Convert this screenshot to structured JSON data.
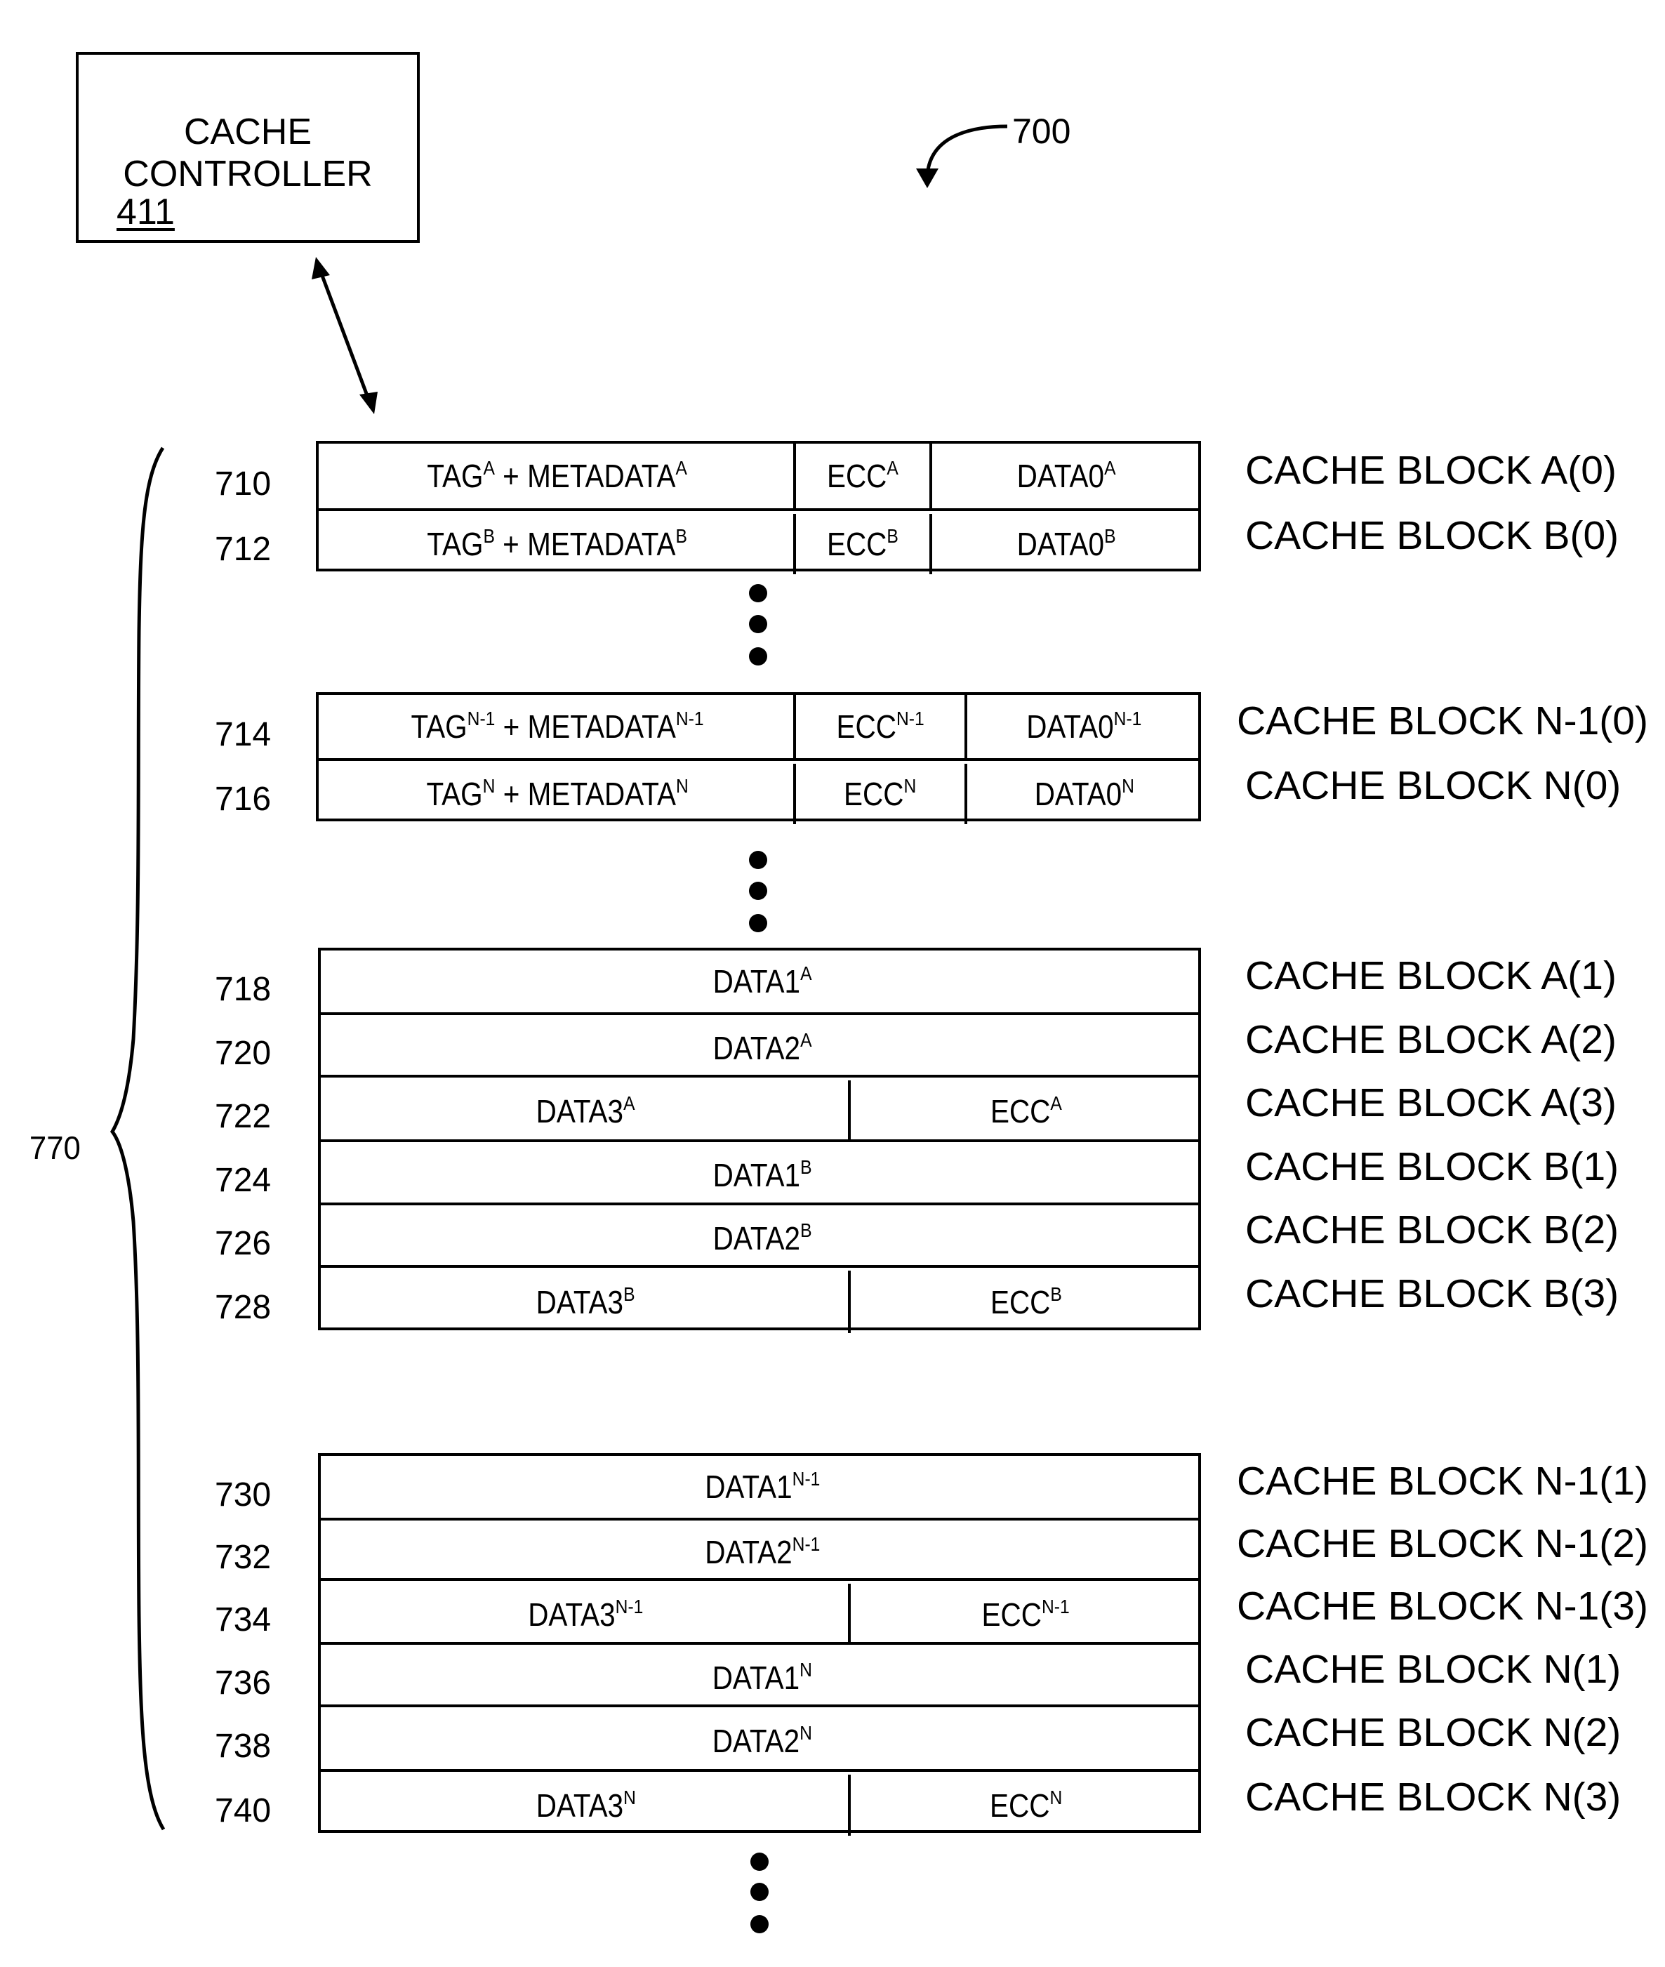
{
  "figure_ref": "700",
  "brace_ref": "770",
  "controller": {
    "line1": "CACHE",
    "line2": "CONTROLLER",
    "ref": "411"
  },
  "groups": [
    {
      "rows": [
        {
          "ref": "710",
          "label": "CACHE BLOCK A(0)",
          "cells": [
            {
              "text": "TAG",
              "sup": "A",
              "text2": " + METADATA",
              "sup2": "A"
            },
            {
              "text": "ECC",
              "sup": "A"
            },
            {
              "text": "DATA0",
              "sup": "A"
            }
          ]
        },
        {
          "ref": "712",
          "label": "CACHE BLOCK B(0)",
          "cells": [
            {
              "text": "TAG",
              "sup": "B",
              "text2": " + METADATA",
              "sup2": "B"
            },
            {
              "text": "ECC",
              "sup": "B"
            },
            {
              "text": "DATA0",
              "sup": "B"
            }
          ]
        }
      ]
    },
    {
      "rows": [
        {
          "ref": "714",
          "label": "CACHE BLOCK N-1(0)",
          "cells": [
            {
              "text": "TAG",
              "sup": "N-1",
              "text2": " + METADATA",
              "sup2": "N-1"
            },
            {
              "text": "ECC",
              "sup": "N-1"
            },
            {
              "text": "DATA0",
              "sup": "N-1"
            }
          ]
        },
        {
          "ref": "716",
          "label": "CACHE BLOCK N(0)",
          "cells": [
            {
              "text": "TAG",
              "sup": "N",
              "text2": " + METADATA",
              "sup2": "N"
            },
            {
              "text": "ECC",
              "sup": "N"
            },
            {
              "text": "DATA0",
              "sup": "N"
            }
          ]
        }
      ]
    },
    {
      "rows": [
        {
          "ref": "718",
          "label": "CACHE BLOCK A(1)",
          "cells": [
            {
              "text": "DATA1",
              "sup": "A"
            }
          ]
        },
        {
          "ref": "720",
          "label": "CACHE BLOCK A(2)",
          "cells": [
            {
              "text": "DATA2",
              "sup": "A"
            }
          ]
        },
        {
          "ref": "722",
          "label": "CACHE BLOCK A(3)",
          "cells": [
            {
              "text": "DATA3",
              "sup": "A"
            },
            {
              "text": "ECC",
              "sup": "A"
            }
          ]
        },
        {
          "ref": "724",
          "label": "CACHE BLOCK B(1)",
          "cells": [
            {
              "text": "DATA1",
              "sup": "B"
            }
          ]
        },
        {
          "ref": "726",
          "label": "CACHE BLOCK B(2)",
          "cells": [
            {
              "text": "DATA2",
              "sup": "B"
            }
          ]
        },
        {
          "ref": "728",
          "label": "CACHE BLOCK B(3)",
          "cells": [
            {
              "text": "DATA3",
              "sup": "B"
            },
            {
              "text": "ECC",
              "sup": "B"
            }
          ]
        }
      ]
    },
    {
      "rows": [
        {
          "ref": "730",
          "label": "CACHE BLOCK N-1(1)",
          "cells": [
            {
              "text": "DATA1",
              "sup": "N-1"
            }
          ]
        },
        {
          "ref": "732",
          "label": "CACHE BLOCK N-1(2)",
          "cells": [
            {
              "text": "DATA2",
              "sup": "N-1"
            }
          ]
        },
        {
          "ref": "734",
          "label": "CACHE BLOCK N-1(3)",
          "cells": [
            {
              "text": "DATA3",
              "sup": "N-1"
            },
            {
              "text": "ECC",
              "sup": "N-1"
            }
          ]
        },
        {
          "ref": "736",
          "label": "CACHE BLOCK N(1)",
          "cells": [
            {
              "text": "DATA1",
              "sup": "N"
            }
          ]
        },
        {
          "ref": "738",
          "label": "CACHE BLOCK N(2)",
          "cells": [
            {
              "text": "DATA2",
              "sup": "N"
            }
          ]
        },
        {
          "ref": "740",
          "label": "CACHE BLOCK N(3)",
          "cells": [
            {
              "text": "DATA3",
              "sup": "N"
            },
            {
              "text": "ECC",
              "sup": "N"
            }
          ]
        }
      ]
    }
  ]
}
